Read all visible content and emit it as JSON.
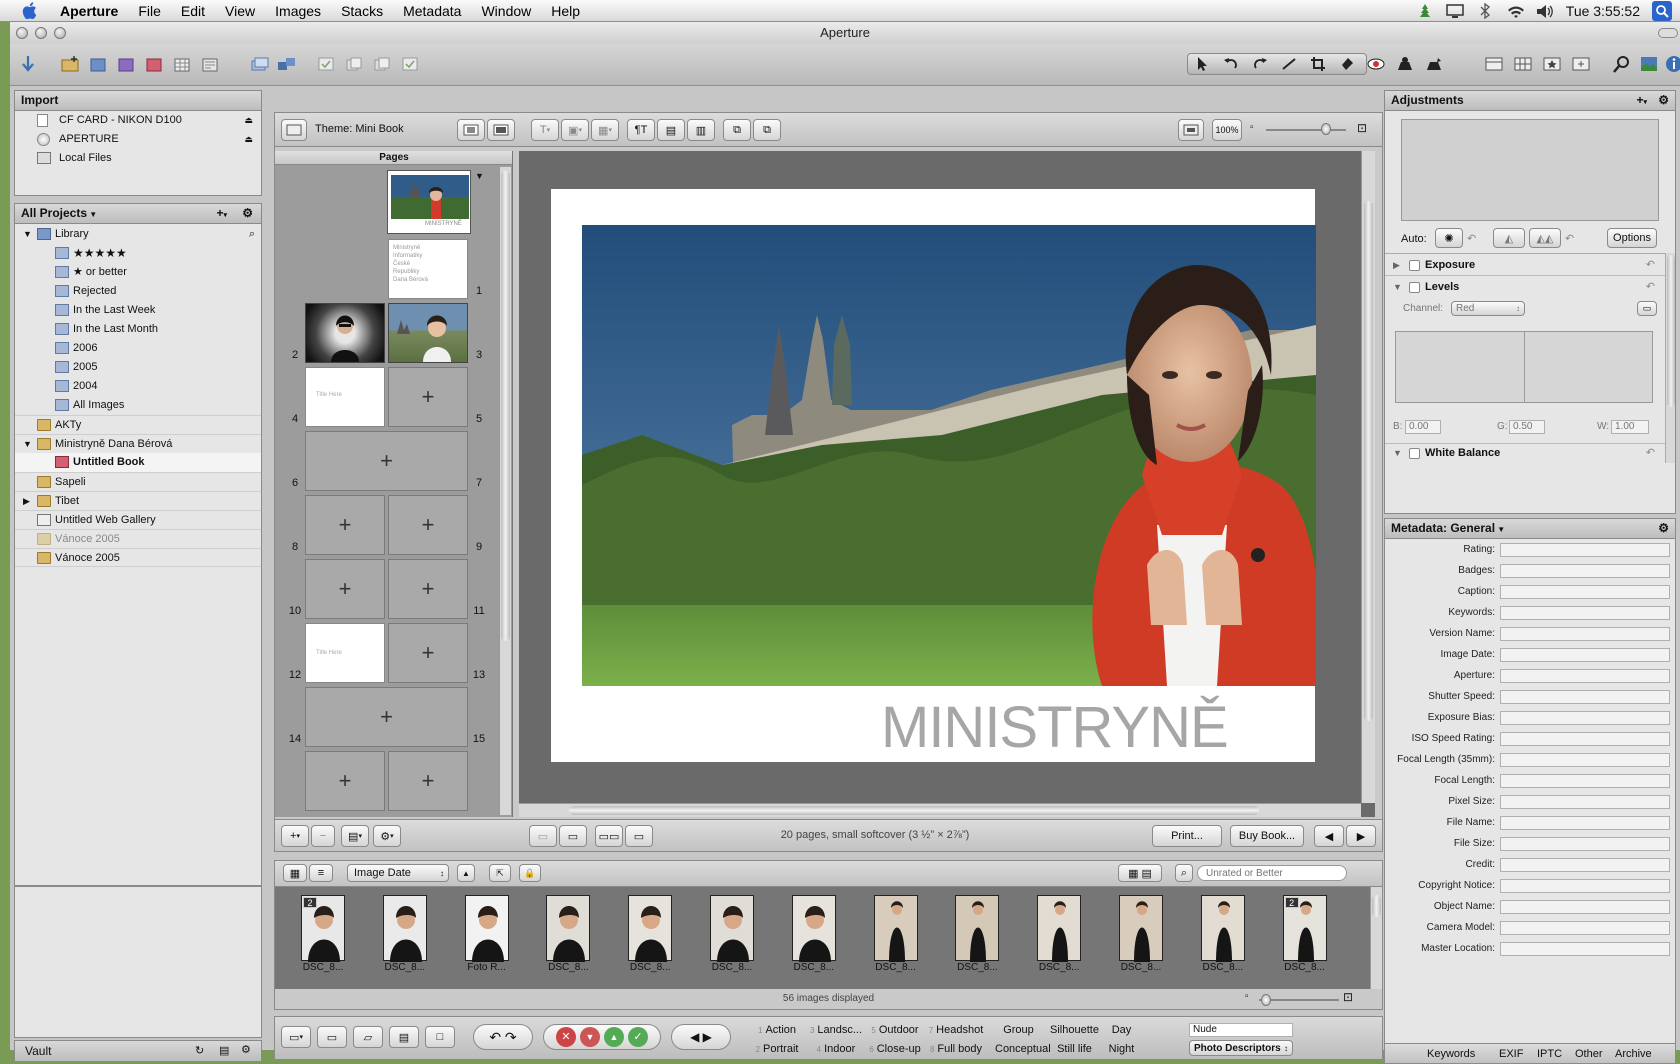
{
  "menubar": {
    "app": "Aperture",
    "items": [
      "File",
      "Edit",
      "View",
      "Images",
      "Stacks",
      "Metadata",
      "Window",
      "Help"
    ],
    "clock": "Tue 3:55:52"
  },
  "window": {
    "title": "Aperture"
  },
  "import": {
    "header": "Import",
    "sources": [
      "CF  CARD - NIKON D100",
      "APERTURE",
      "Local Files"
    ]
  },
  "projects": {
    "header": "All Projects",
    "library": "Library",
    "smart": [
      "★★★★★",
      "★ or better",
      "Rejected",
      "In the Last Week",
      "In the Last Month",
      "2006",
      "2005",
      "2004",
      "All Images"
    ],
    "items": [
      "AKTy",
      "Ministryně Dana Bérová",
      "Untitled Book",
      "Sapeli",
      "Tibet",
      "Untitled Web Gallery",
      "Vánoce 2005",
      "Vánoce 2005"
    ]
  },
  "vault": {
    "label": "Vault"
  },
  "book": {
    "theme": "Theme: Mini Book",
    "zoom": "100%",
    "pages_header": "Pages",
    "cover_caption": "MINISTRYNĚ",
    "page1_text": "Ministryně Informatiky České Republiky Dana Bérová",
    "title_here": "Title Here",
    "page_numbers": [
      "1",
      "2",
      "3",
      "4",
      "5",
      "6",
      "7",
      "8",
      "9",
      "10",
      "11",
      "12",
      "13",
      "14",
      "15"
    ],
    "spread_title": "MINISTRYNĚ",
    "status": "20 pages, small softcover (3 ½” × 2⅞”)",
    "print": "Print...",
    "buy": "Buy Book..."
  },
  "browser": {
    "sort": "Image Date",
    "search_placeholder": "Unrated or Better",
    "count": "56 images displayed",
    "captions": [
      "DSC_8...",
      "DSC_8...",
      "Foto R...",
      "DSC_8...",
      "DSC_8...",
      "DSC_8...",
      "DSC_8...",
      "DSC_8...",
      "DSC_8...",
      "DSC_8...",
      "DSC_8...",
      "DSC_8...",
      "DSC_8..."
    ],
    "stack_badge": "2"
  },
  "keywords": {
    "row1": [
      {
        "n": "1",
        "t": "Action"
      },
      {
        "n": "3",
        "t": "Landsc..."
      },
      {
        "n": "5",
        "t": "Outdoor"
      },
      {
        "n": "7",
        "t": "Headshot"
      },
      {
        "n": "",
        "t": "Group"
      },
      {
        "n": "",
        "t": "Silhouette"
      },
      {
        "n": "",
        "t": "Day"
      }
    ],
    "row2": [
      {
        "n": "2",
        "t": "Portrait"
      },
      {
        "n": "4",
        "t": "Indoor"
      },
      {
        "n": "6",
        "t": "Close-up"
      },
      {
        "n": "8",
        "t": "Full body"
      },
      {
        "n": "",
        "t": "Conceptual"
      },
      {
        "n": "",
        "t": "Still life"
      },
      {
        "n": "",
        "t": "Night"
      }
    ],
    "field": "Nude",
    "set": "Photo Descriptors"
  },
  "adjustments": {
    "header": "Adjustments",
    "auto": "Auto:",
    "options": "Options",
    "exposure": "Exposure",
    "levels": "Levels",
    "channel_label": "Channel:",
    "channel": "Red",
    "b_label": "B:",
    "b": "0.00",
    "g_label": "G:",
    "g": "0.50",
    "w_label": "W:",
    "w": "1.00",
    "white_balance": "White Balance"
  },
  "metadata": {
    "header": "Metadata: General",
    "fields": [
      "Rating:",
      "Badges:",
      "Caption:",
      "Keywords:",
      "Version Name:",
      "Image Date:",
      "Aperture:",
      "Shutter Speed:",
      "Exposure Bias:",
      "ISO Speed Rating:",
      "Focal Length (35mm):",
      "Focal Length:",
      "Pixel Size:",
      "File Name:",
      "File Size:",
      "Credit:",
      "Copyright Notice:",
      "Object Name:",
      "Camera Model:",
      "Master Location:"
    ],
    "tabs": [
      "Keywords",
      "EXIF",
      "IPTC",
      "Other",
      "Archive"
    ]
  },
  "colors": {
    "accent": "#3d6fd1",
    "bg": "#c6c6c6",
    "canvas": "#6a6a6a"
  }
}
